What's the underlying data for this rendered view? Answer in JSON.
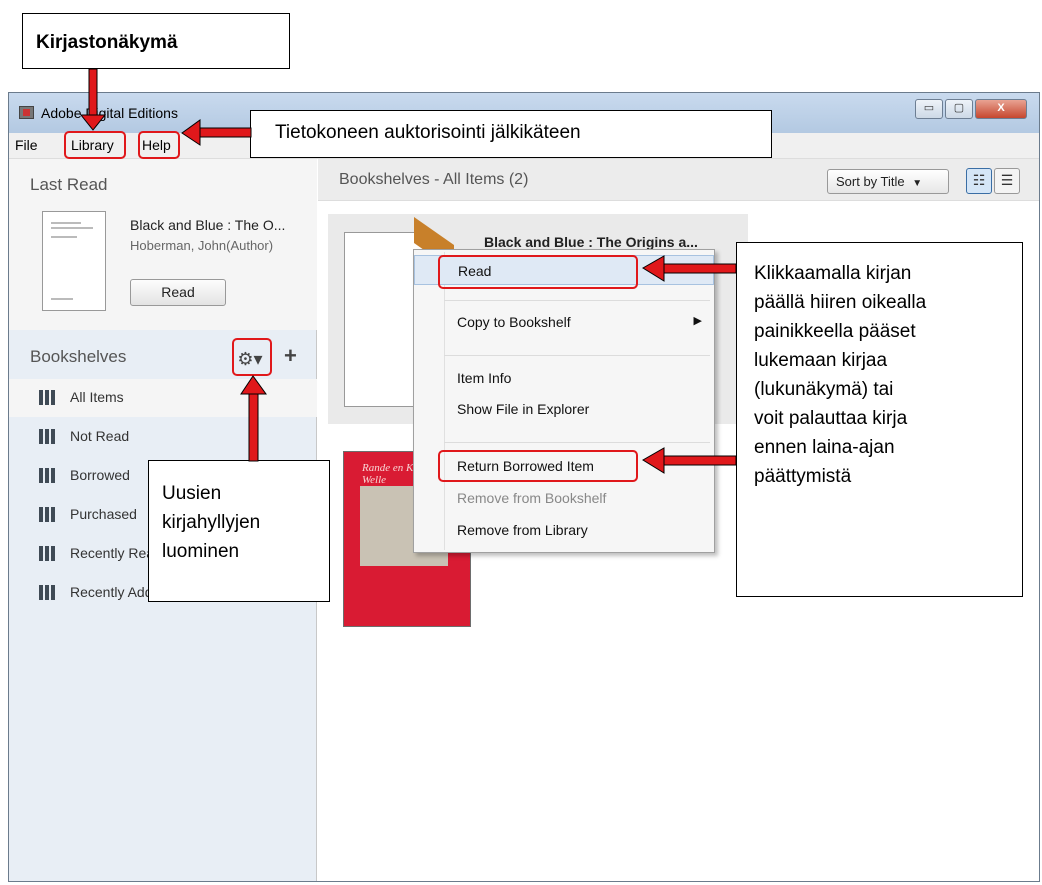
{
  "window": {
    "title": "Adobe Digital Editions",
    "caption_buttons": {
      "minimize": "▭",
      "maximize": "▢",
      "close": "X"
    }
  },
  "menubar": {
    "file": "File",
    "library": "Library",
    "help": "Help"
  },
  "sidebar": {
    "last_read_title": "Last Read",
    "last_read_book_title": "Black and Blue : The O...",
    "last_read_author": "Hoberman, John(Author)",
    "read_button": "Read",
    "bookshelves_title": "Bookshelves",
    "gear_icon": "gear-icon",
    "plus_label": "+",
    "shelves": [
      {
        "label": "All Items"
      },
      {
        "label": "Not Read"
      },
      {
        "label": "Borrowed"
      },
      {
        "label": "Purchased"
      },
      {
        "label": "Recently Read"
      },
      {
        "label": "Recently Added"
      }
    ]
  },
  "main": {
    "header_title": "Bookshelves - All Items (2)",
    "sort_label": "Sort by Title",
    "book1_title": "Black and Blue : The Origins a...",
    "book2_cover_text": "Rande en Kunst en te Welle"
  },
  "context_menu": {
    "items": [
      {
        "label": "Read"
      },
      {
        "label": "Copy to Bookshelf"
      },
      {
        "label": "Item Info"
      },
      {
        "label": "Show File in Explorer"
      },
      {
        "label": "Return Borrowed Item"
      },
      {
        "label": "Remove from Bookshelf"
      },
      {
        "label": "Remove from Library"
      }
    ]
  },
  "annotations": {
    "top": "Kirjastonäkymä",
    "help": "Tietokoneen auktorisointi jälkikäteen",
    "right": [
      "Klikkaamalla kirjan",
      "päällä hiiren oikealla",
      "painikkeella pääset",
      "lukemaan kirjaa",
      "(lukunäkymä) tai",
      "voit palauttaa kirja",
      "ennen laina-ajan",
      "päättymistä"
    ],
    "bottom": [
      "Uusien",
      "kirjahyllyjen",
      "luominen"
    ]
  },
  "colors": {
    "highlight": "#e0181b",
    "titlebar": "#c9daee",
    "sidebar": "#e8eef5"
  }
}
